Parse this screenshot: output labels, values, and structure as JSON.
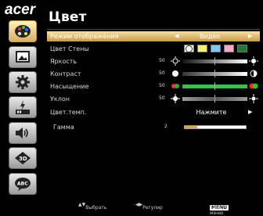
{
  "brand": {
    "logo": "acer"
  },
  "page": {
    "title": "Цвет"
  },
  "sidebar": {
    "items": [
      {
        "icon": "palette-icon",
        "active": true
      },
      {
        "icon": "picture-icon",
        "active": false
      },
      {
        "icon": "gear-icon",
        "active": false
      },
      {
        "icon": "power-battery-icon",
        "active": false
      },
      {
        "icon": "speaker-icon",
        "active": false
      },
      {
        "icon": "3d-icon",
        "active": false
      },
      {
        "icon": "language-abc-icon",
        "active": false
      }
    ]
  },
  "menu": {
    "display_mode": {
      "label": "Режим отображения",
      "value": "Видео"
    },
    "wall_color": {
      "label": "Цвет Стены",
      "swatches": [
        "#ffffff",
        "#f6f06a",
        "#7fc7f0",
        "#f7a8c8",
        "#1f7a3a"
      ]
    },
    "brightness": {
      "label": "Яркость",
      "value": "50",
      "level": 0.5
    },
    "contrast": {
      "label": "Контраст",
      "value": "50",
      "level": 0.5
    },
    "saturation": {
      "label": "Насыщение",
      "value": "50",
      "level": 0.5
    },
    "tint": {
      "label": "Уклон",
      "value": "50",
      "level": 0.5
    },
    "color_temp": {
      "label": "Цвет.темп.",
      "value": "Нажмите"
    },
    "gamma": {
      "label": "Гамма",
      "value": "2",
      "level": 0.2
    }
  },
  "footer": {
    "select_label": "Выбрать",
    "adjust_label": "Регулир",
    "menu_key": "MENU",
    "main_menu_label": "Глав. меню"
  },
  "colors": {
    "accent": "#d9a94a",
    "track_orange": "#d9a94a",
    "saturation_green": "#35c44a"
  }
}
